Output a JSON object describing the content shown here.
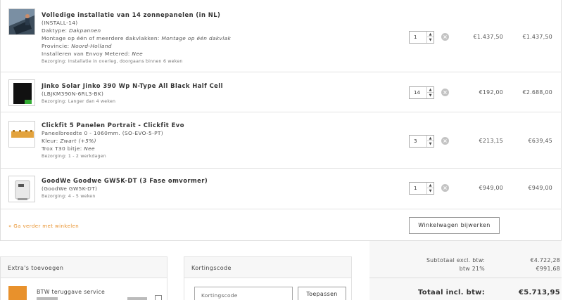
{
  "cart": {
    "items": [
      {
        "name": "Volledige installatie van 14 zonnepanelen (in NL)",
        "sku": "(INSTALL-14)",
        "details": [
          {
            "label": "Daktype: ",
            "value": "Dakpannen"
          },
          {
            "label": "Montage op één of meerdere dakvlakken: ",
            "value": "Montage op één dakvlak"
          },
          {
            "label": "Provincie: ",
            "value": "Noord-Holland"
          },
          {
            "label": "Installeren van Envoy Metered: ",
            "value": "Nee"
          }
        ],
        "delivery": "Bezorging: Installatie in overleg, doorgaans binnen 6 weken",
        "qty": "1",
        "price": "€1.437,50",
        "total": "€1.437,50"
      },
      {
        "name": "Jinko Solar Jinko 390 Wp N-Type All Black Half Cell",
        "sku": "(LBJKM390N-6RL3-BK)",
        "details": [],
        "delivery": "Bezorging: Langer dan 4 weken",
        "qty": "14",
        "price": "€192,00",
        "total": "€2.688,00"
      },
      {
        "name": "Clickfit 5 Panelen Portrait - Clickfit Evo",
        "sku": "Paneelbreedte 0 - 1060mm. (SO-EVO-5-PT)",
        "details": [
          {
            "label": "Kleur: ",
            "value": "Zwart (+5%)"
          },
          {
            "label": "Trox T30 bitje: ",
            "value": "Nee"
          }
        ],
        "delivery": "Bezorging: 1 - 2 werkdagen",
        "qty": "3",
        "price": "€213,15",
        "total": "€639,45"
      },
      {
        "name": "GoodWe Goodwe GW5K-DT (3 Fase omvormer)",
        "sku": "(GoodWe GW5K-DT)",
        "details": [],
        "delivery": "Bezorging: 4 - 5 weken",
        "qty": "1",
        "price": "€949,00",
        "total": "€949,00"
      }
    ],
    "continue_label": "« Ga verder met winkelen",
    "update_label": "Winkelwagen bijwerken"
  },
  "extras": {
    "title": "Extra's toevoegen",
    "item_label": "BTW teruggave service"
  },
  "coupon": {
    "title": "Kortingscode",
    "placeholder": "Kortingscode",
    "button": "Toepassen"
  },
  "summary": {
    "subtotal_label": "Subtotaal excl. btw:",
    "subtotal_value": "€4.722,28",
    "vat_label": "btw 21%",
    "vat_value": "€991,68",
    "grand_label": "Totaal incl. btw:",
    "grand_value": "€5.713,95"
  },
  "colors": {
    "accent": "#e8912c",
    "border": "#dedede",
    "panel_bg": "#f7f7f7"
  },
  "icons": {
    "remove": "close-circle-icon",
    "spin_up": "chevron-up-icon",
    "spin_down": "chevron-down-icon"
  }
}
